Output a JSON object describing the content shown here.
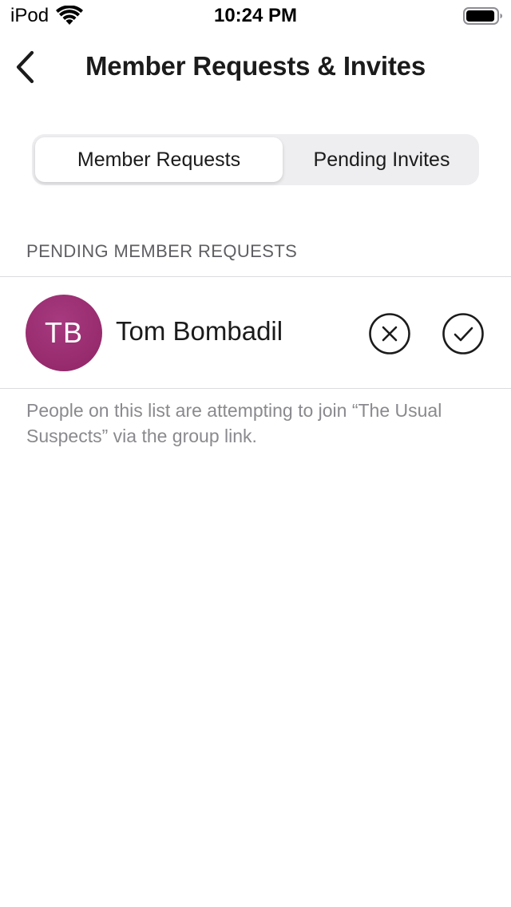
{
  "status_bar": {
    "carrier": "iPod",
    "time": "10:24 PM",
    "wifi_icon": "wifi-icon",
    "battery_icon": "battery-icon",
    "battery_level": 0.95
  },
  "nav": {
    "title": "Member Requests & Invites",
    "back_icon": "chevron-left-icon"
  },
  "segments": {
    "items": [
      {
        "label": "Member Requests",
        "selected": true
      },
      {
        "label": "Pending Invites",
        "selected": false
      }
    ]
  },
  "section": {
    "header": "PENDING MEMBER REQUESTS",
    "requests": [
      {
        "initials": "TB",
        "name": "Tom Bombadil",
        "avatar_color": "#9b2d72",
        "deny_icon": "x-circle-icon",
        "approve_icon": "check-circle-icon"
      }
    ],
    "footer": "People on this list are attempting to join “The Usual Suspects” via the group link."
  },
  "colors": {
    "segment_bg": "#eeeef0",
    "divider": "#dcdcdf",
    "secondary_text": "#8a8a8e",
    "header_text": "#5f5f63"
  }
}
